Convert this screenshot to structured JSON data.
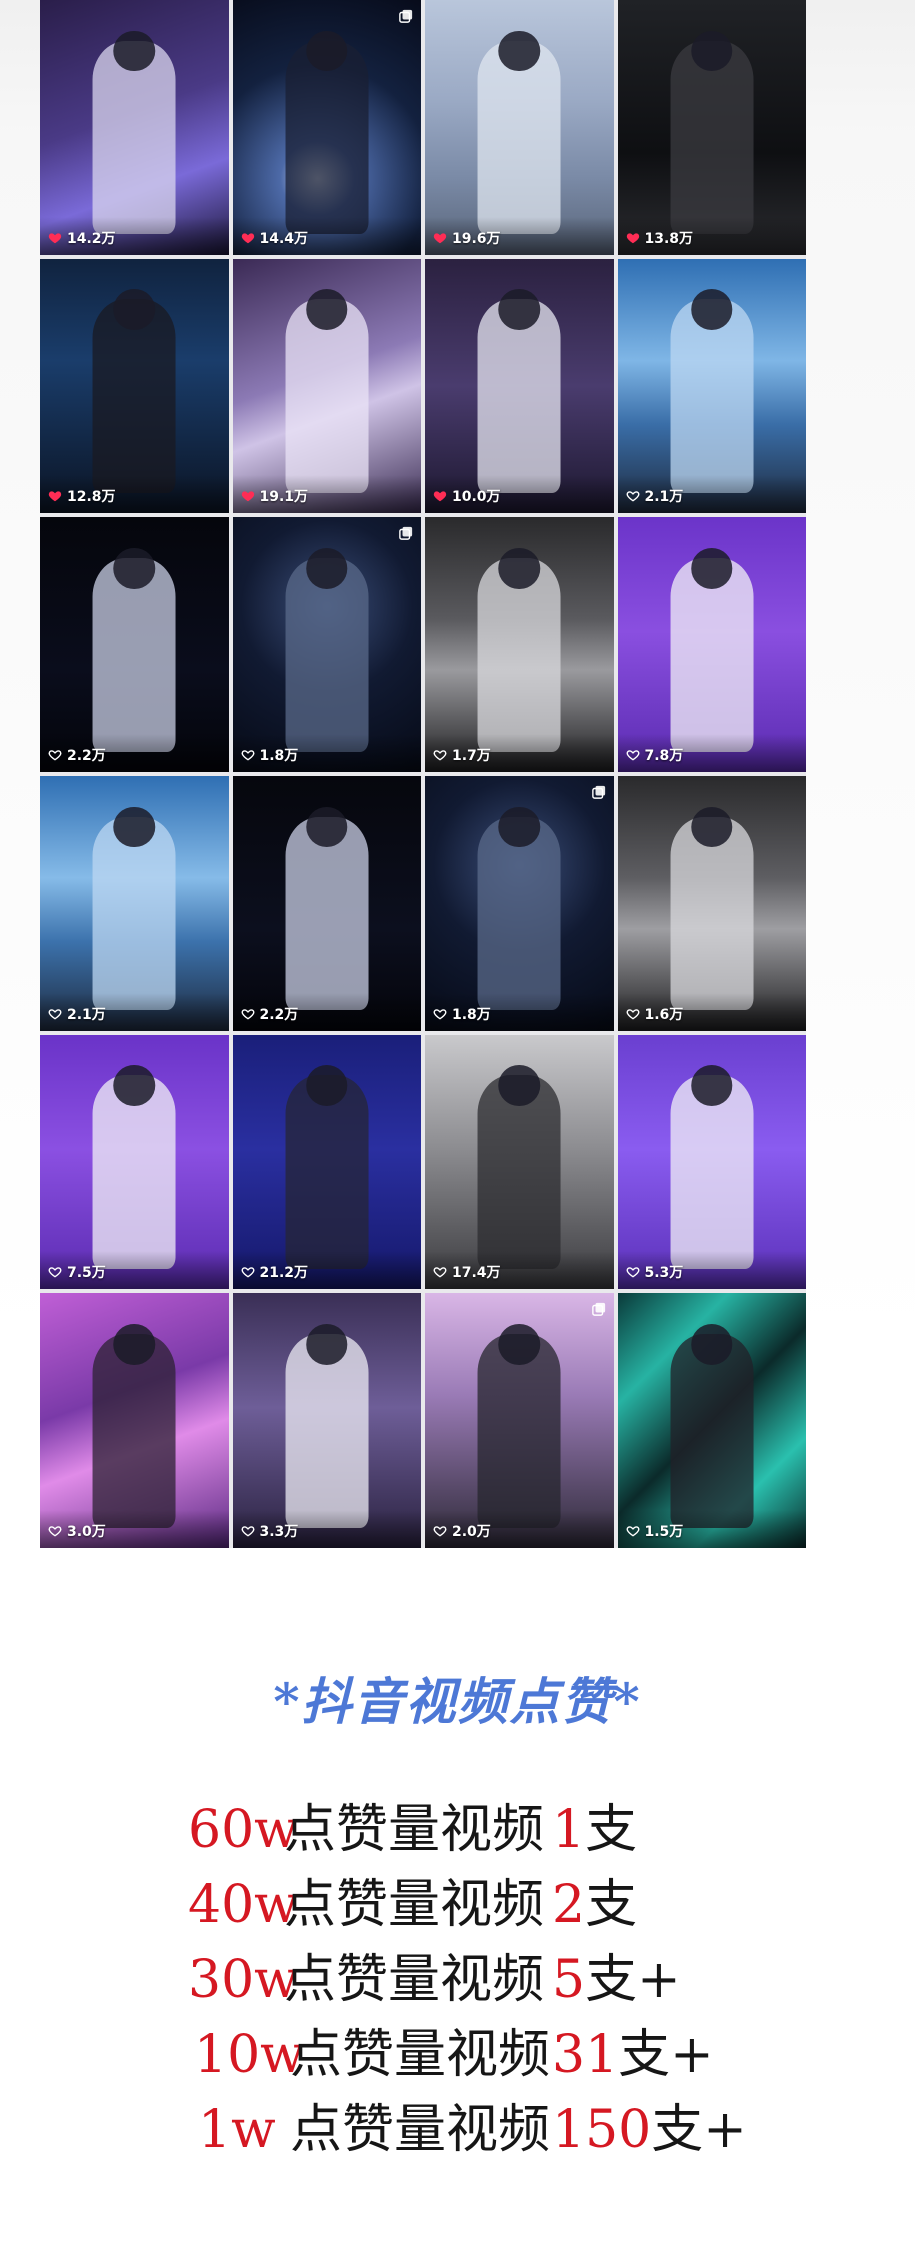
{
  "videos": [
    {
      "likes": "14.2万",
      "liked": true,
      "multi": false,
      "bg": "linear-gradient(160deg,#2a1e4a 0%,#4a3a86 45%,#7a6ad8 70%,#1b1638 100%)",
      "fig": "#d9d6ee"
    },
    {
      "likes": "14.4万",
      "liked": true,
      "multi": true,
      "bg": "radial-gradient(circle at 45% 70%,#e8f0ff 0%,#4d6aa8 18%,#13213f 55%,#070b1a 100%)",
      "fig": "#1a1f33"
    },
    {
      "likes": "19.6万",
      "liked": true,
      "multi": false,
      "bg": "linear-gradient(180deg,#b9c6db 0%,#9aa9c4 40%,#7a8aa6 70%,#586479 100%)",
      "fig": "#dfe5ef"
    },
    {
      "likes": "13.8万",
      "liked": true,
      "multi": false,
      "bg": "linear-gradient(180deg,#202226 0%,#0e0f12 60%,#2b2c30 100%)",
      "fig": "#3b3b40"
    },
    {
      "likes": "12.8万",
      "liked": true,
      "multi": false,
      "bg": "linear-gradient(180deg,#10233f 0%,#1a3d6b 40%,#0b1424 100%)",
      "fig": "#1a1a22"
    },
    {
      "likes": "19.1万",
      "liked": true,
      "multi": false,
      "bg": "linear-gradient(160deg,#3b2a55 0%,#8c7ab5 45%,#cfc3e6 60%,#3a2c52 100%)",
      "fig": "#eae3f5"
    },
    {
      "likes": "10.0万",
      "liked": true,
      "multi": false,
      "bg": "linear-gradient(180deg,#2b2140 0%,#4a3c6e 50%,#1d1830 100%)",
      "fig": "#e6e6f0"
    },
    {
      "likes": "2.1万",
      "liked": false,
      "multi": false,
      "bg": "linear-gradient(180deg,#2f6fb3 0%,#7fb6e6 40%,#3a6ea8 65%,#1e2a3e 100%)",
      "fig": "#bcd7f2"
    },
    {
      "likes": "2.2万",
      "liked": false,
      "multi": false,
      "bg": "linear-gradient(180deg,#05060c 0%,#0a0d1c 60%,#03040a 100%)",
      "fig": "#c9cfe6"
    },
    {
      "likes": "1.8万",
      "liked": false,
      "multi": true,
      "bg": "radial-gradient(circle at 50% 35%,#3a4d78 0%,#111a32 45%,#060a16 100%)",
      "fig": "#5a6a8a"
    },
    {
      "likes": "1.7万",
      "liked": false,
      "multi": false,
      "bg": "linear-gradient(180deg,#2a2a2c 0%,#5a5a5e 40%,#9a9a9e 60%,#1e1e20 100%)",
      "fig": "#d8d8dc"
    },
    {
      "likes": "7.8万",
      "liked": false,
      "multi": false,
      "bg": "linear-gradient(180deg,#6b34c9 0%,#8a4fe0 45%,#5a2bb0 100%)",
      "fig": "#f2f0f6"
    },
    {
      "likes": "2.1万",
      "liked": false,
      "multi": false,
      "bg": "linear-gradient(180deg,#2f6fb3 0%,#86bbe8 40%,#3c72ac 65%,#1e2a3e 100%)",
      "fig": "#bcd7f2"
    },
    {
      "likes": "2.2万",
      "liked": false,
      "multi": false,
      "bg": "linear-gradient(180deg,#06070d 0%,#0c0f1e 60%,#04050b 100%)",
      "fig": "#c9cfe6"
    },
    {
      "likes": "1.8万",
      "liked": false,
      "multi": true,
      "bg": "radial-gradient(circle at 50% 35%,#3a4d78 0%,#111a32 45%,#060a16 100%)",
      "fig": "#5a6a8a"
    },
    {
      "likes": "1.6万",
      "liked": false,
      "multi": false,
      "bg": "linear-gradient(180deg,#2a2a2c 0%,#5e5e62 40%,#9e9ea2 60%,#1e1e20 100%)",
      "fig": "#d8d8dc"
    },
    {
      "likes": "7.5万",
      "liked": false,
      "multi": false,
      "bg": "linear-gradient(180deg,#6a33c8 0%,#8b50e2 45%,#5a2bb0 100%)",
      "fig": "#f2f0f6"
    },
    {
      "likes": "21.2万",
      "liked": false,
      "multi": false,
      "bg": "linear-gradient(180deg,#1a1f7a 0%,#2a2fa0 45%,#15186a 100%)",
      "fig": "#262636"
    },
    {
      "likes": "17.4万",
      "liked": false,
      "multi": false,
      "bg": "linear-gradient(180deg,#c9c9cc 0%,#8c8c90 45%,#3a3a3e 100%)",
      "fig": "#2c2c30"
    },
    {
      "likes": "5.3万",
      "liked": false,
      "multi": false,
      "bg": "linear-gradient(180deg,#6a3fd0 0%,#8a5cf0 45%,#5a30b8 100%)",
      "fig": "#f2f0f6"
    },
    {
      "likes": "3.0万",
      "liked": false,
      "multi": false,
      "bg": "linear-gradient(160deg,#c05fd6 0%,#7a3aa8 40%,#e08be8 60%,#5a2a82 100%)",
      "fig": "#2c2233"
    },
    {
      "likes": "3.3万",
      "liked": false,
      "multi": false,
      "bg": "linear-gradient(180deg,#3a2f56 0%,#6e5e98 45%,#2a2240 100%)",
      "fig": "#ecebf3"
    },
    {
      "likes": "2.0万",
      "liked": false,
      "multi": true,
      "bg": "linear-gradient(180deg,#d9b6e6 0%,#9a7bb6 40%,#2e2a38 100%)",
      "fig": "#26262e"
    },
    {
      "likes": "1.5万",
      "liked": false,
      "multi": false,
      "bg": "linear-gradient(135deg,#0a3a3a 0%,#27b3a3 25%,#0b2a2a 50%,#2ac0ae 75%,#0a2a2a 100%)",
      "fig": "#222028"
    }
  ],
  "section_title": "*抖音视频点赞*",
  "stats": [
    {
      "threshold": "60w",
      "label": "点赞量视频",
      "count": "1",
      "unit": "支"
    },
    {
      "threshold": "40w",
      "label": "点赞量视频",
      "count": "2",
      "unit": "支"
    },
    {
      "threshold": "30w",
      "label": "点赞量视频",
      "count": "5",
      "unit": "支+"
    },
    {
      "threshold": "10w",
      "label": "点赞量视频",
      "count": "31",
      "unit": "支+"
    },
    {
      "threshold": "1w",
      "label": "点赞量视频",
      "count": "150",
      "unit": "支+"
    }
  ],
  "colors": {
    "title_blue": "#4d78d6",
    "stat_red": "#d51822",
    "stat_black": "#161616"
  }
}
